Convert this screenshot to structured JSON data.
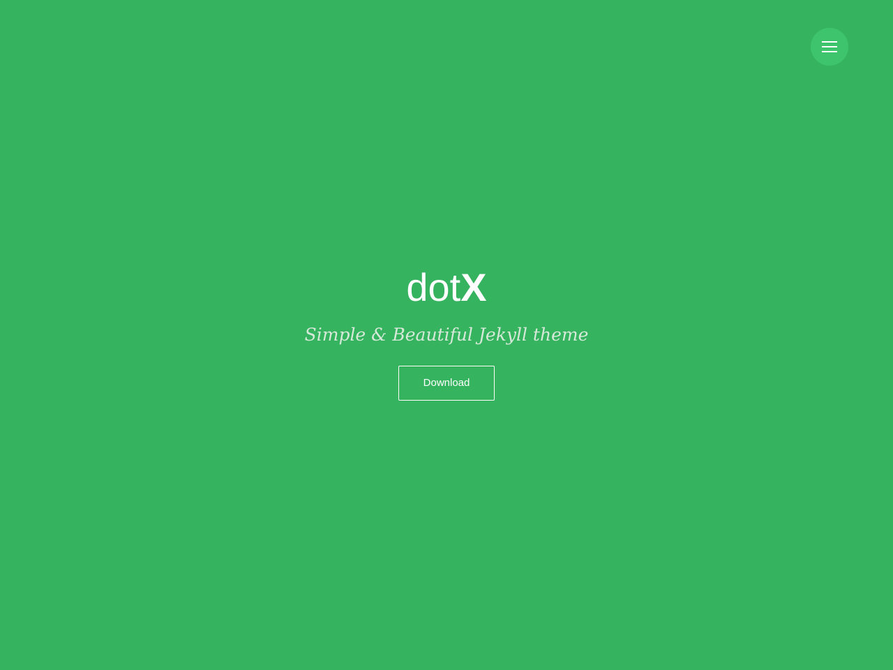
{
  "colors": {
    "background": "#35b35f",
    "menu_button": "#3fc46e",
    "text": "#ffffff",
    "tagline": "#d6e9d9"
  },
  "header": {
    "menu_icon": "hamburger-menu-icon"
  },
  "hero": {
    "logo_part_1": "dot",
    "logo_part_2": "X",
    "tagline": "Simple & Beautiful Jekyll theme",
    "download_label": "Download"
  }
}
